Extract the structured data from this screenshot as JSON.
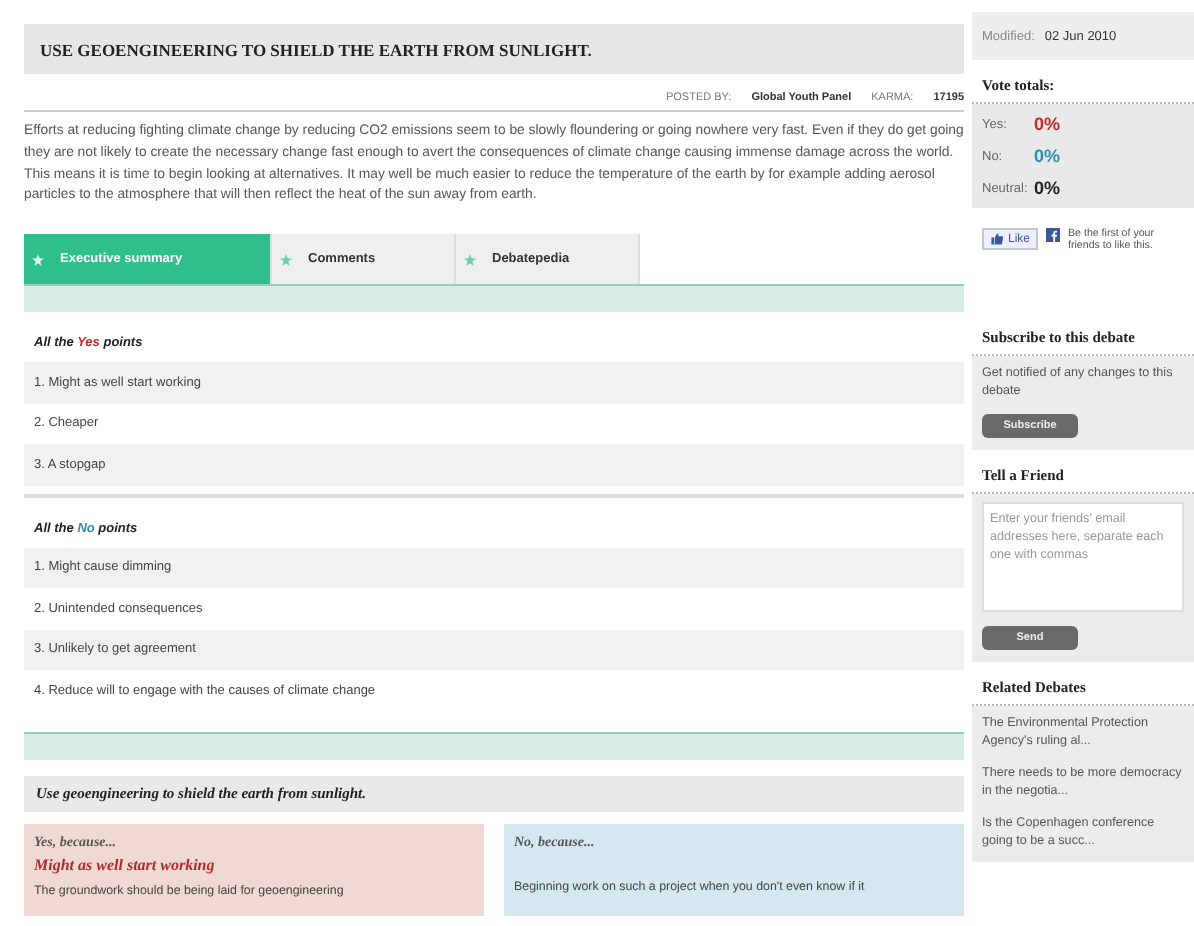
{
  "debate": {
    "title": "USE GEOENGINEERING TO SHIELD THE EARTH FROM SUNLIGHT.",
    "posted_by_label": "POSTED BY:",
    "posted_by": "Global Youth Panel",
    "karma_label": "KARMA:",
    "karma": "17195",
    "description": "Efforts at reducing fighting climate change by reducing CO2 emissions seem to be slowly floundering or going nowhere very fast. Even if they do get going they are not likely to create the necessary change fast enough to avert the consequences of climate change causing immense damage across the world. This means it is time to begin looking at alternatives. It may well be much easier to reduce the temperature of the earth by for example adding aerosol particles to the atmosphere that will then reflect the heat of the sun away from earth.",
    "tabs": [
      {
        "label": "Executive summary",
        "selected": true
      },
      {
        "label": "Comments",
        "selected": false
      },
      {
        "label": "Debatepedia",
        "selected": false
      }
    ],
    "point_groups": [
      {
        "kind": "yes",
        "prefix": "All the",
        "word": "Yes",
        "suffix": "points",
        "items": [
          "1. Might as well start working",
          "2. Cheaper",
          "3. A stopgap"
        ]
      },
      {
        "kind": "no",
        "prefix": "All the",
        "word": "No",
        "suffix": "points",
        "items": [
          "1. Might cause dimming",
          "2. Unintended consequences",
          "3. Unlikely to get agreement",
          "4. Reduce will to engage with the causes of climate change"
        ]
      }
    ],
    "summary_title": "Use geoengineering to shield the earth from sunlight.",
    "arguments": [
      {
        "kind": "yes",
        "heading": "Yes, because...",
        "point": "Might as well start working",
        "text": "The groundwork should be being laid for geoengineering"
      },
      {
        "kind": "no",
        "heading": "No, because...",
        "text": "Beginning work on such a project when you don't even know if it"
      }
    ]
  },
  "sidebar": {
    "modified_label": "Modified:",
    "modified": "02 Jun 2010",
    "vote_title": "Vote totals:",
    "votes": [
      {
        "kind": "yes",
        "label": "Yes:",
        "value": "0%"
      },
      {
        "kind": "no",
        "label": "No:",
        "value": "0%"
      },
      {
        "kind": "neutral",
        "label": "Neutral:",
        "value": "0%"
      }
    ],
    "like_label": "Like",
    "like_text": "Be the first of your friends to like this.",
    "subscribe": {
      "title": "Subscribe to this debate",
      "text": "Get notified of any changes to this debate",
      "button": "Subscribe"
    },
    "tell": {
      "title": "Tell a Friend",
      "placeholder": "Enter your friends' email addresses here, separate each one with commas",
      "button": "Send"
    },
    "related": {
      "title": "Related Debates",
      "items": [
        "The Environmental Protection Agency's ruling al...",
        "There needs to be more democracy in the negotia...",
        "Is the Copenhagen conference going to be a succ..."
      ]
    }
  }
}
